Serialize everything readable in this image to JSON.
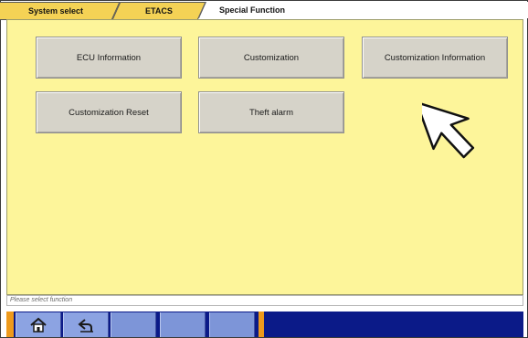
{
  "breadcrumb": [
    {
      "label": "System select"
    },
    {
      "label": "ETACS"
    },
    {
      "label": "Special Function"
    }
  ],
  "functions": {
    "ecu_information": "ECU Information",
    "customization": "Customization",
    "customization_information": "Customization Information",
    "customization_reset": "Customization Reset",
    "theft_alarm": "Theft alarm"
  },
  "status_text": "Please select function",
  "toolbar": {
    "icons": [
      "home-icon",
      "back-icon"
    ]
  },
  "colors": {
    "main_bg": "#fdf59a",
    "active_tab": "#f4d255",
    "toolbar_bg": "#0b1a88",
    "toolbar_button": "#8ca3e2",
    "toolbar_accent": "#ee9a1c"
  }
}
